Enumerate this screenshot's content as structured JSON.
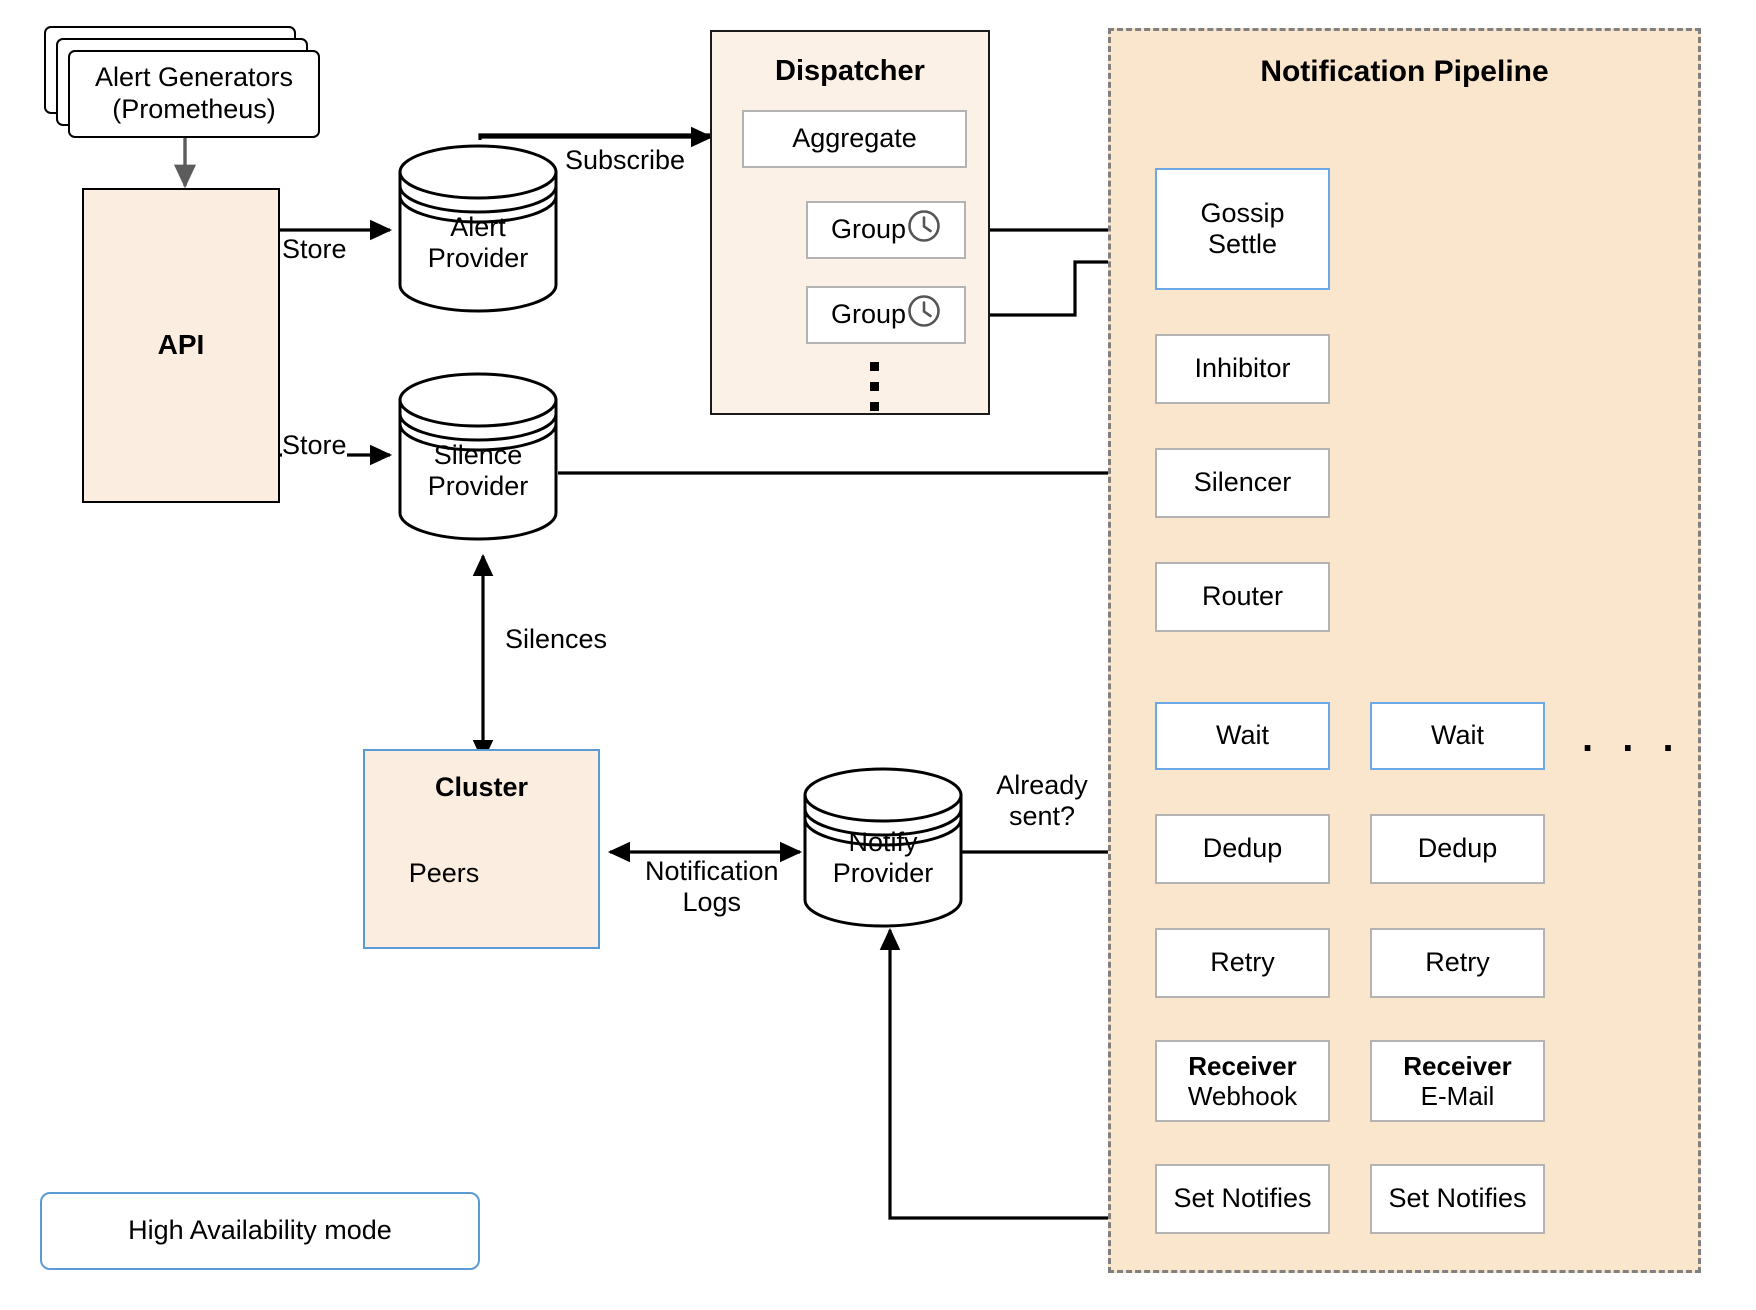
{
  "diagram": {
    "title_notification_pipeline": "Notification Pipeline",
    "title_dispatcher": "Dispatcher",
    "title_cluster": "Cluster",
    "legend_label": "High Availability mode",
    "colors": {
      "pipeline_fill": "#fae6cc",
      "dispatcher_fill": "#fcf1e6",
      "api_fill": "#fbeee1",
      "ha_accent": "#5b9bd5",
      "box_border": "#b3b3b3",
      "retry_arrow": "#c0392b",
      "line": "#000000",
      "pipeline_border": "#808080"
    }
  },
  "sources": {
    "alert_generators": {
      "line1": "Alert Generators",
      "line2": "(Prometheus)"
    },
    "api_label": "API"
  },
  "datastores": [
    {
      "name": "alert-provider",
      "line1": "Alert",
      "line2": "Provider"
    },
    {
      "name": "silence-provider",
      "line1": "Silence",
      "line2": "Provider"
    },
    {
      "name": "notify-provider",
      "line1": "Notify",
      "line2": "Provider"
    }
  ],
  "cluster": {
    "title": "Cluster",
    "peers_label": "Peers"
  },
  "dispatcher": {
    "title": "Dispatcher",
    "aggregate_label": "Aggregate",
    "groups": [
      {
        "label": "Group",
        "icon": "clock-icon"
      },
      {
        "label": "Group",
        "icon": "clock-icon"
      }
    ],
    "more_indicator": "vertical-ellipsis"
  },
  "pipeline": {
    "title": "Notification Pipeline",
    "shared_stages": [
      {
        "name": "gossip-settle",
        "label": "Gossip\nSettle",
        "line1": "Gossip",
        "line2": "Settle",
        "ha": true
      },
      {
        "name": "inhibitor",
        "label": "Inhibitor",
        "ha": false
      },
      {
        "name": "silencer",
        "label": "Silencer",
        "ha": false
      },
      {
        "name": "router",
        "label": "Router",
        "ha": false
      }
    ],
    "branches": [
      {
        "name": "webhook-branch",
        "stages": [
          {
            "name": "wait",
            "label": "Wait",
            "ha": true
          },
          {
            "name": "dedup",
            "label": "Dedup",
            "ha": false
          },
          {
            "name": "retry",
            "label": "Retry",
            "ha": false
          },
          {
            "name": "receiver",
            "label_bold": "Receiver",
            "label_sub": "Webhook",
            "ha": false
          },
          {
            "name": "set-notifies",
            "label": "Set Notifies",
            "ha": false
          }
        ]
      },
      {
        "name": "email-branch",
        "stages": [
          {
            "name": "wait",
            "label": "Wait",
            "ha": true
          },
          {
            "name": "dedup",
            "label": "Dedup",
            "ha": false
          },
          {
            "name": "retry",
            "label": "Retry",
            "ha": false
          },
          {
            "name": "receiver",
            "label_bold": "Receiver",
            "label_sub": "E-Mail",
            "ha": false
          },
          {
            "name": "set-notifies",
            "label": "Set Notifies",
            "ha": false
          }
        ]
      }
    ],
    "more_branches_indicator": ". . ."
  },
  "edge_labels": {
    "store_alert": "Store",
    "store_silence": "Store",
    "subscribe": "Subscribe",
    "silences": "Silences",
    "notification_logs_line1": "Notification",
    "notification_logs_line2": "Logs",
    "already_sent_line1": "Already",
    "already_sent_line2": "sent?"
  }
}
